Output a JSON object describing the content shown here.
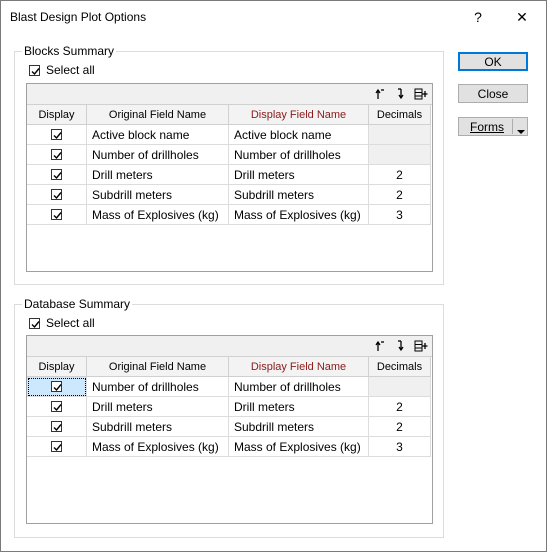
{
  "window": {
    "title": "Blast Design Plot Options",
    "help_glyph": "?",
    "close_glyph": "✕"
  },
  "buttons": {
    "ok": "OK",
    "close": "Close",
    "forms": "Forms"
  },
  "blocks_summary": {
    "label": "Blocks Summary",
    "select_all": "Select all",
    "columns": [
      "Display",
      "Original Field Name",
      "Display Field Name",
      "Decimals"
    ],
    "rows": [
      {
        "checked": true,
        "original": "Active block name",
        "display": "Active block name",
        "decimals": ""
      },
      {
        "checked": true,
        "original": "Number of drillholes",
        "display": "Number of drillholes",
        "decimals": ""
      },
      {
        "checked": true,
        "original": "Drill meters",
        "display": "Drill meters",
        "decimals": "2"
      },
      {
        "checked": true,
        "original": "Subdrill meters",
        "display": "Subdrill meters",
        "decimals": "2"
      },
      {
        "checked": true,
        "original": "Mass of Explosives (kg)",
        "display": "Mass of Explosives (kg)",
        "decimals": "3"
      }
    ]
  },
  "database_summary": {
    "label": "Database Summary",
    "select_all": "Select all",
    "columns": [
      "Display",
      "Original Field Name",
      "Display Field Name",
      "Decimals"
    ],
    "rows": [
      {
        "checked": true,
        "original": "Number of drillholes",
        "display": "Number of drillholes",
        "decimals": ""
      },
      {
        "checked": true,
        "original": "Drill meters",
        "display": "Drill meters",
        "decimals": "2"
      },
      {
        "checked": true,
        "original": "Subdrill meters",
        "display": "Subdrill meters",
        "decimals": "2"
      },
      {
        "checked": true,
        "original": "Mass of Explosives (kg)",
        "display": "Mass of Explosives (kg)",
        "decimals": "3"
      }
    ]
  },
  "toolbar_icons": [
    "move-up-icon",
    "move-down-icon",
    "insert-row-icon"
  ],
  "colors": {
    "display_header": "#8b1a1a",
    "selected_cell": "#cce8ff",
    "default_button_border": "#0078d7"
  }
}
